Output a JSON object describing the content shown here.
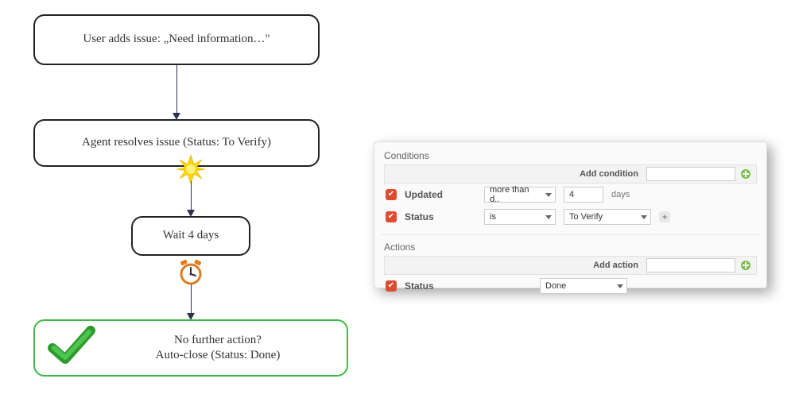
{
  "flow": {
    "step1": "User adds issue: „Need information…\"",
    "step2": "Agent resolves issue (Status: To Verify)",
    "step3": "Wait 4 days",
    "step4_line1": "No further action?",
    "step4_line2": "Auto-close (Status: Done)"
  },
  "panel": {
    "conditions_title": "Conditions",
    "add_condition_label": "Add condition",
    "cond_updated": {
      "label": "Updated",
      "operator": "more than d..",
      "value": "4",
      "unit": "days"
    },
    "cond_status": {
      "label": "Status",
      "operator": "is",
      "value": "To Verify"
    },
    "actions_title": "Actions",
    "add_action_label": "Add action",
    "action_status": {
      "label": "Status",
      "value": "Done"
    }
  }
}
